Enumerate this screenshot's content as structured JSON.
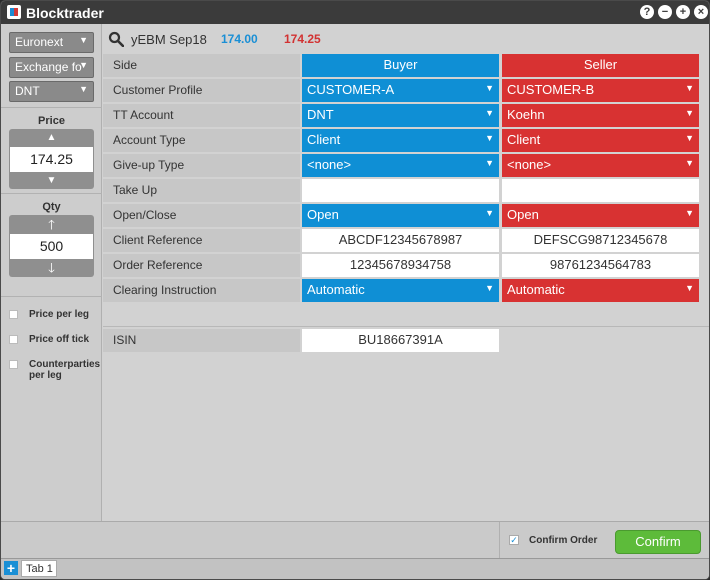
{
  "app": {
    "title": "Blocktrader"
  },
  "title_buttons": [
    "?",
    "−",
    "+",
    "×"
  ],
  "left": {
    "dropdowns": [
      "Euronext",
      "Exchange fo",
      "DNT"
    ],
    "price": {
      "label": "Price",
      "value": "174.25"
    },
    "qty": {
      "label": "Qty",
      "value": "500"
    },
    "checkboxes": [
      {
        "label": "Price per leg",
        "checked": false
      },
      {
        "label": "Price off tick",
        "checked": false
      },
      {
        "label": "Counterparties per leg",
        "checked": false
      }
    ]
  },
  "instrument": {
    "name": "yEBM Sep18",
    "bid": "174.00",
    "ask": "174.25"
  },
  "table": {
    "rows": [
      {
        "label": "Side",
        "buyer": "Buyer",
        "seller": "Seller"
      },
      {
        "label": "Customer Profile",
        "buyer": "CUSTOMER-A",
        "seller": "CUSTOMER-B"
      },
      {
        "label": "TT Account",
        "buyer": "DNT",
        "seller": "Koehn"
      },
      {
        "label": "Account Type",
        "buyer": "Client",
        "seller": "Client"
      },
      {
        "label": "Give-up Type",
        "buyer": "<none>",
        "seller": "<none>"
      },
      {
        "label": "Take Up",
        "buyer": "",
        "seller": ""
      },
      {
        "label": "Open/Close",
        "buyer": "Open",
        "seller": "Open"
      },
      {
        "label": "Client Reference",
        "buyer": "ABCDF12345678987",
        "seller": "DEFSCG98712345678"
      },
      {
        "label": "Order Reference",
        "buyer": "12345678934758",
        "seller": "98761234564783"
      },
      {
        "label": "Clearing Instruction",
        "buyer": "Automatic",
        "seller": "Automatic"
      }
    ],
    "isin": {
      "label": "ISIN",
      "value": "BU18667391A"
    }
  },
  "footer": {
    "confirm_order_label": "Confirm Order",
    "confirm_order_checked": true,
    "confirm_button": "Confirm"
  },
  "tabs": {
    "add": "+",
    "items": [
      "Tab 1"
    ]
  },
  "colors": {
    "buyer": "#0f8fd5",
    "seller": "#d83232",
    "confirm": "#5dbb3a"
  }
}
